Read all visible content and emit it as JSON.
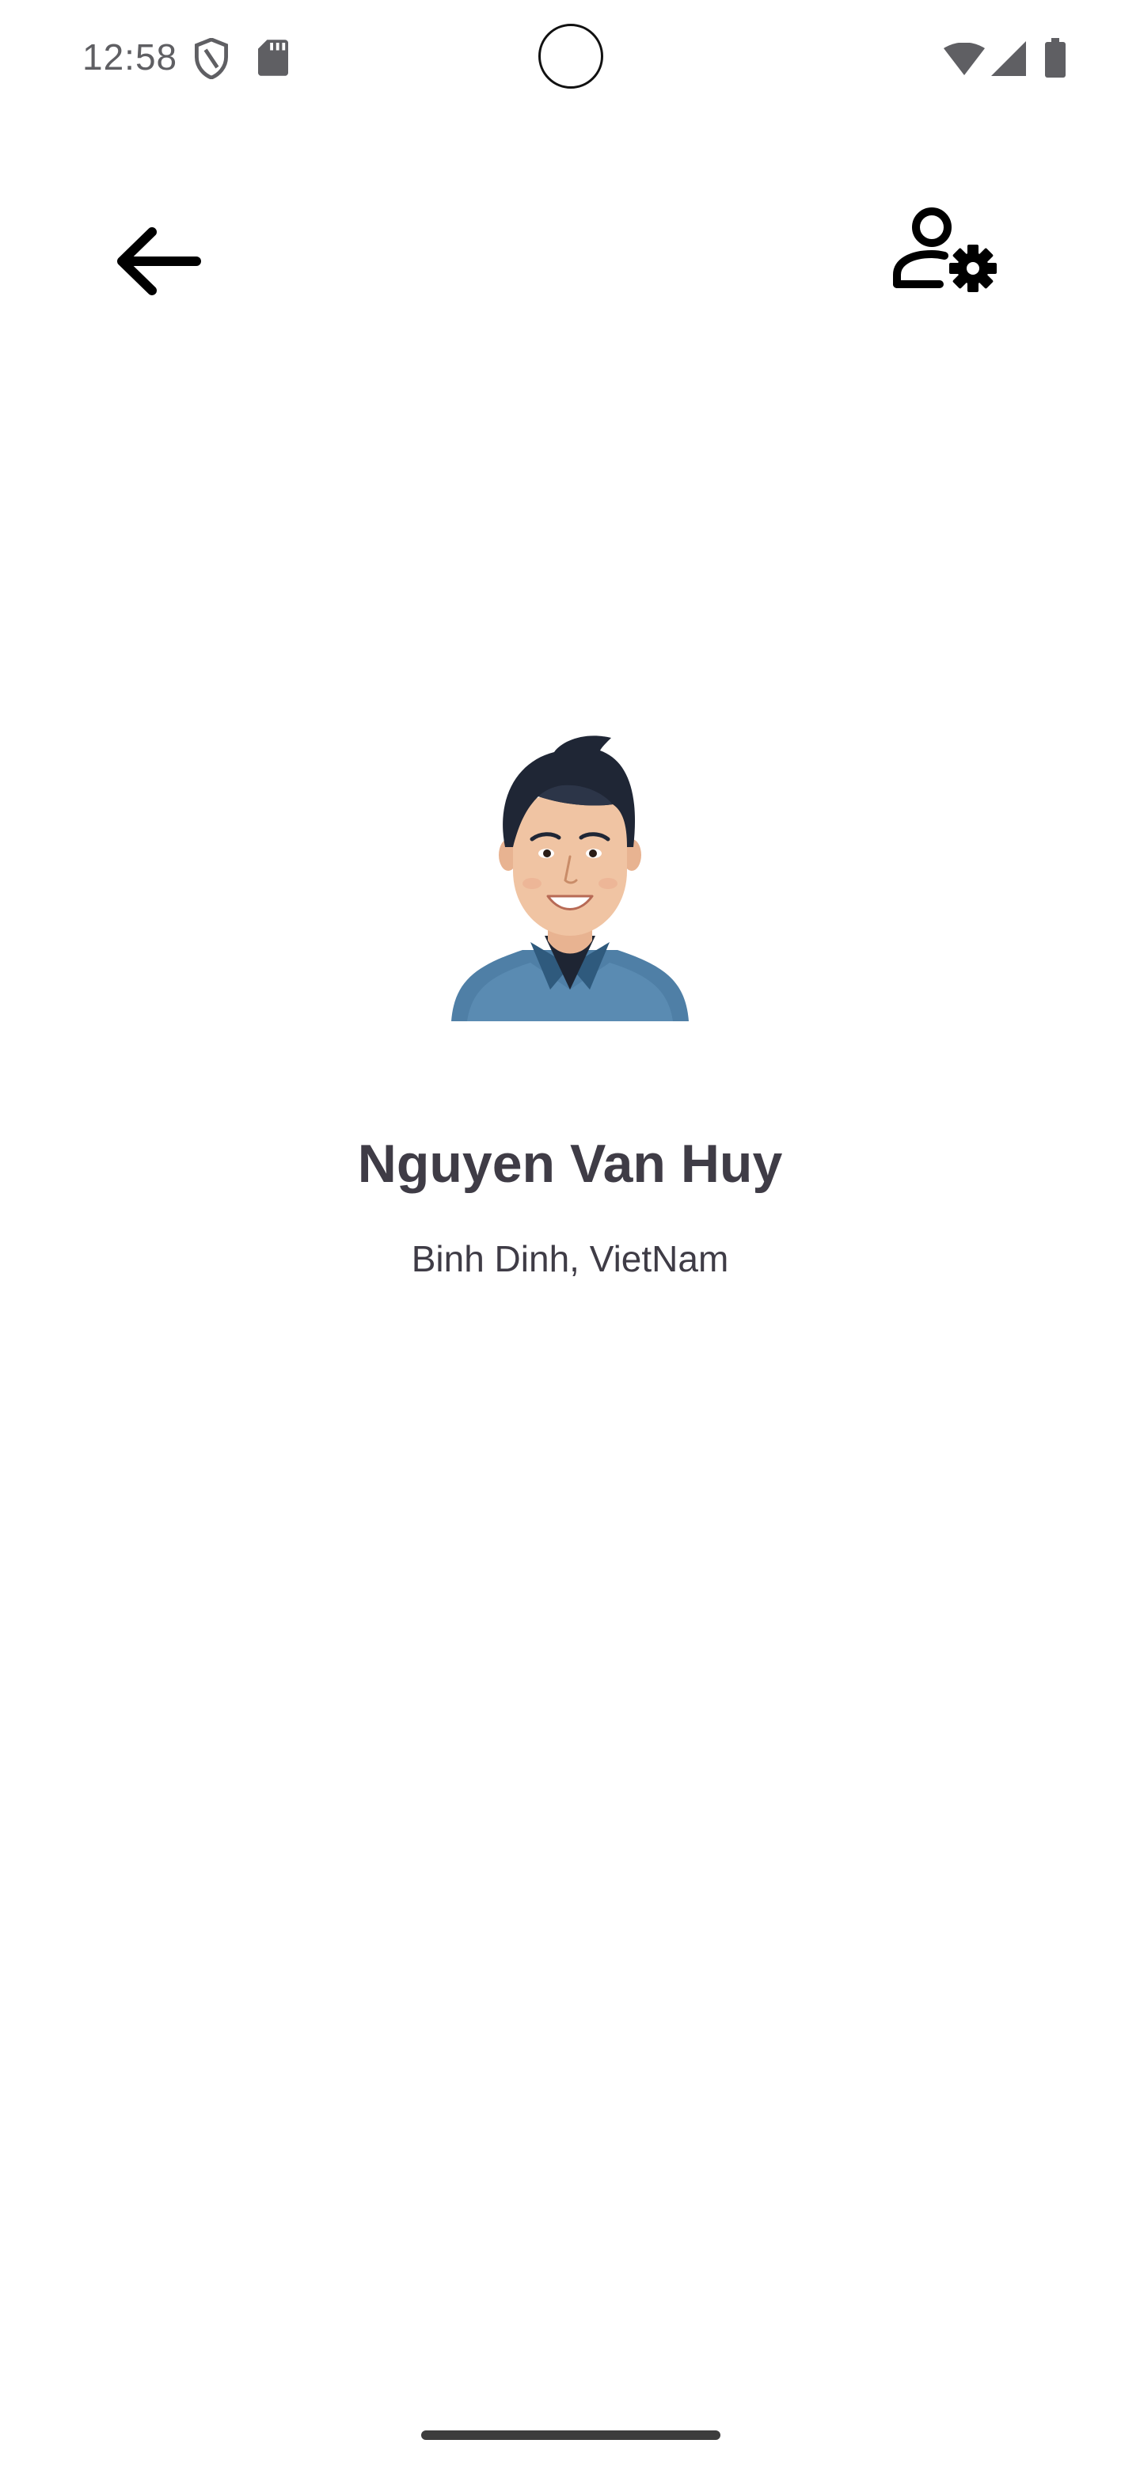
{
  "status_bar": {
    "time": "12:58",
    "icons": [
      "shield-icon",
      "sd-card-icon",
      "wifi-icon",
      "signal-icon",
      "battery-icon"
    ]
  },
  "app_bar": {
    "back_icon": "arrow-back-icon",
    "settings_icon": "manage-accounts-icon"
  },
  "profile": {
    "name": "Nguyen Van Huy",
    "location": "Binh Dinh, VietNam",
    "avatar": "avatar-illustration"
  },
  "colors": {
    "text": "#3f3c46",
    "background": "#ffffff",
    "icon": "#000000",
    "shirt": "#4f7fa6",
    "hair": "#1f2635"
  }
}
